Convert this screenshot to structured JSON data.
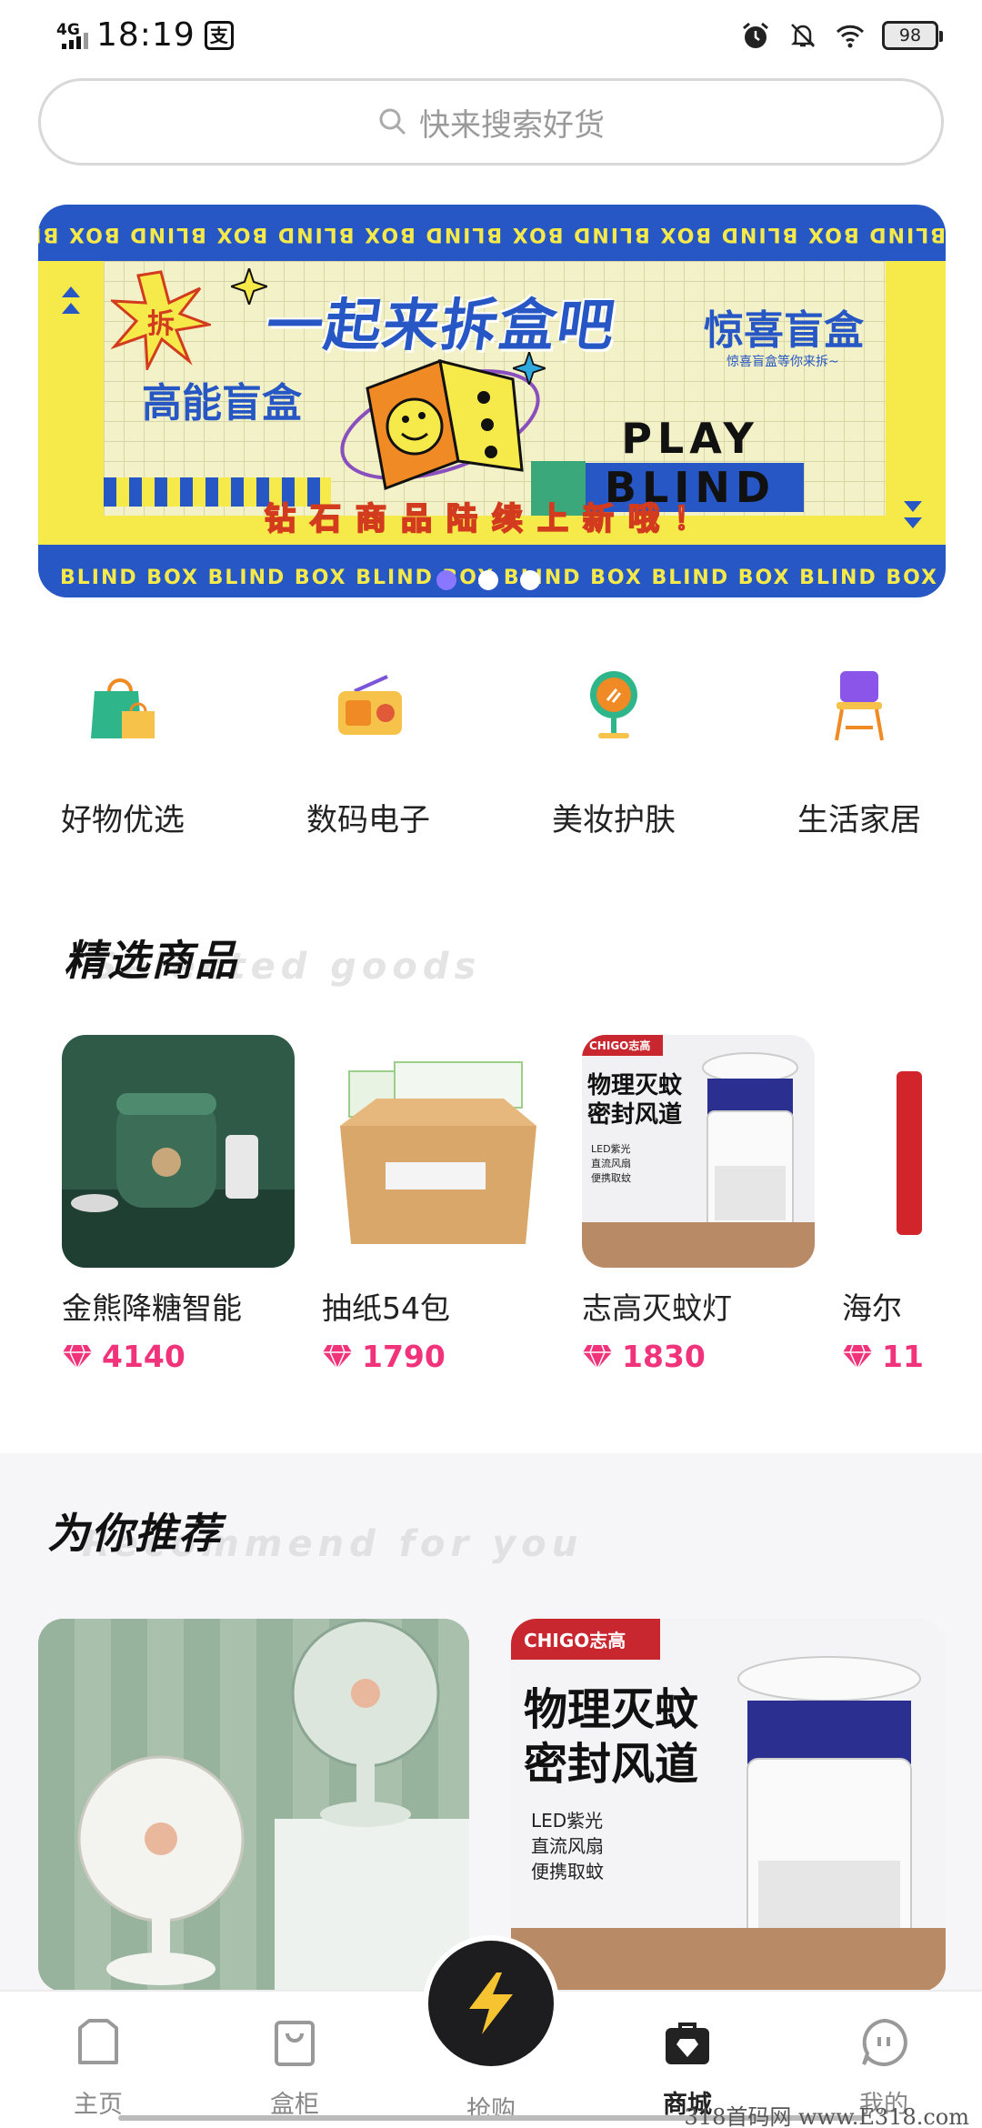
{
  "status_bar": {
    "network": "4G",
    "time": "18:19",
    "app_badge": "支",
    "battery": "98",
    "icons": [
      "alarm-icon",
      "mute-bell-icon",
      "wifi-icon"
    ]
  },
  "search": {
    "placeholder": "快来搜索好货"
  },
  "banner": {
    "border_text": "BLIND BOX BLIND BOX BLIND BOX BLIND BOX BLIND BOX BLIND BOX BLIND BOX",
    "title": "一起来拆盒吧",
    "burst_text": "拆",
    "left_label": "高能盲盒",
    "right_label": "惊喜盲盒",
    "right_sub": "惊喜盲盒等你来拆~",
    "play": "PLAY",
    "blind": "BLIND",
    "caption": "钻石商品陆续上新哦！",
    "slides": 3,
    "active_slide": 1,
    "colors": {
      "blue": "#2657c4",
      "yellow": "#f6e94a"
    }
  },
  "categories": [
    {
      "label": "好物优选",
      "icon": "shopping-bag-icon"
    },
    {
      "label": "数码电子",
      "icon": "radio-icon"
    },
    {
      "label": "美妆护肤",
      "icon": "mirror-icon"
    },
    {
      "label": "生活家居",
      "icon": "chair-icon"
    }
  ],
  "featured": {
    "title": "精选商品",
    "subtitle": "Selected goods",
    "items": [
      {
        "name": "金熊降糖智能",
        "price": "4140"
      },
      {
        "name": "抽纸54包",
        "price": "1790"
      },
      {
        "name": "志高灭蚊灯",
        "price": "1830",
        "image_text": [
          "物理灭蚊",
          "密封风道"
        ],
        "bullets": [
          "LED紫光",
          "直流风扇",
          "便携取蚊"
        ],
        "brand": "CHIGO志高"
      },
      {
        "name": "海尔",
        "price": "11"
      }
    ]
  },
  "recommend": {
    "title": "为你推荐",
    "subtitle": "Recommend for you",
    "cards": [
      {
        "kind": "fan"
      },
      {
        "kind": "mosquito-lamp",
        "brand": "CHIGO志高",
        "headline": [
          "物理灭蚊",
          "密封风道"
        ],
        "bullets": [
          "LED紫光",
          "直流风扇",
          "便携取蚊"
        ]
      }
    ]
  },
  "bottom_nav": {
    "items": [
      {
        "label": "主页",
        "icon": "home-icon"
      },
      {
        "label": "盒柜",
        "icon": "bag-icon"
      },
      {
        "label": "抢购",
        "icon": "lightning-icon"
      },
      {
        "label": "商城",
        "icon": "shop-diamond-icon",
        "active": true
      },
      {
        "label": "我的",
        "icon": "profile-chat-icon"
      }
    ]
  },
  "watermark": "318首码网 www.E318.com"
}
